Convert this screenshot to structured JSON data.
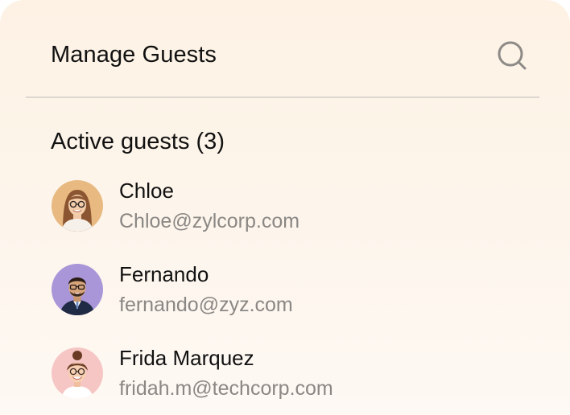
{
  "header": {
    "title": "Manage Guests",
    "search_icon": "search-icon"
  },
  "section": {
    "title": "Active guests (3)"
  },
  "guests": [
    {
      "name": "Chloe",
      "email": "Chloe@zylcorp.com",
      "avatar_bg": "#e8b981"
    },
    {
      "name": "Fernando",
      "email": "fernando@zyz.com",
      "avatar_bg": "#a996d8"
    },
    {
      "name": "Frida Marquez",
      "email": "fridah.m@techcorp.com",
      "avatar_bg": "#f6c6c4"
    }
  ],
  "colors": {
    "panel_bg": "#fdf3e6",
    "divider": "#dcd7d1",
    "email_text": "#8a8784",
    "primary_text": "#111111"
  }
}
